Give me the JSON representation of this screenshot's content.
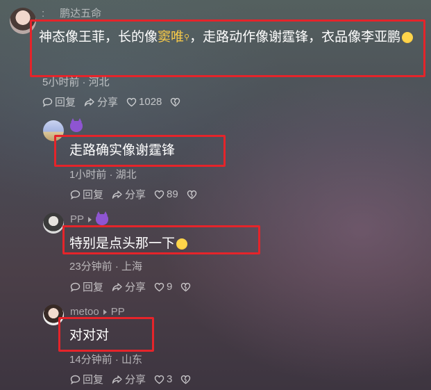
{
  "main_comment": {
    "user": "鹏达五命",
    "text_before": "神态像王菲，长的像",
    "link": "窦唯",
    "text_after": "，走路动作像谢霆锋，衣品像李亚鹏",
    "meta": "5小时前 · 河北",
    "reply_label": "回复",
    "share_label": "分享",
    "likes": "1028"
  },
  "replies": [
    {
      "user": "",
      "text": "走路确实像谢霆锋",
      "meta": "1小时前 · 湖北",
      "reply_label": "回复",
      "share_label": "分享",
      "likes": "89"
    },
    {
      "user": "PP",
      "text": "特别是点头那一下",
      "meta": "23分钟前 · 上海",
      "reply_label": "回复",
      "share_label": "分享",
      "likes": "9"
    },
    {
      "user": "metoo",
      "reply_to": "PP",
      "text": "对对对",
      "meta": "14分钟前 · 山东",
      "reply_label": "回复",
      "share_label": "分享",
      "likes": "3"
    }
  ],
  "colors": {
    "highlight_box": "#e5242a",
    "link": "#f6c948",
    "badge": "#8e55d1"
  },
  "icons": [
    "comment-bubble-icon",
    "share-arrow-icon",
    "heart-icon",
    "broken-heart-icon",
    "devil-badge-icon",
    "magnify-icon",
    "emoji-icon"
  ]
}
